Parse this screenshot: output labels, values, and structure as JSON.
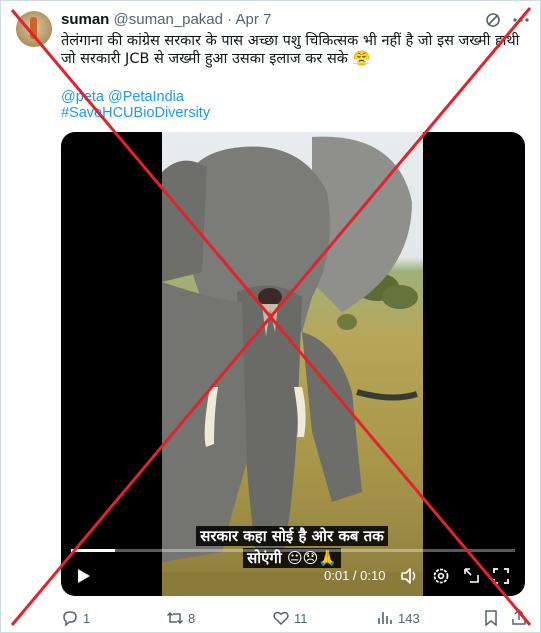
{
  "tweet": {
    "display_name": "suman",
    "handle": "@suman_pakad",
    "separator": "·",
    "date": "Apr 7",
    "text": "तेलंगाना की कांग्रेस सरकार के पास अच्छा पशु चिकित्सक भी नहीं है जो इस जख्मी हाथी जो सरकारी JCB से जख्मी हुआ उसका इलाज कर सके 😤",
    "mentions": "@peta @PetaIndia",
    "hashtag": "#SaveHCUBioDiversity"
  },
  "video": {
    "caption_line1": "सरकार कहा सोई है ओर कब तक",
    "caption_line2": "सोएंगी 😐😞🙏",
    "time": "0:01 / 0:10",
    "progress": 0.1
  },
  "actions": {
    "replies": "1",
    "reposts": "8",
    "likes": "11",
    "views": "143"
  },
  "colors": {
    "link": "#1d9bf0",
    "muted": "#536471",
    "overlay_x": "#e0242a"
  },
  "icons": [
    "grok-icon",
    "more-icon",
    "play-icon",
    "volume-icon",
    "settings-icon",
    "fullscreen-icon",
    "reply-icon",
    "repost-icon",
    "like-icon",
    "views-icon",
    "bookmark-icon",
    "share-icon"
  ]
}
